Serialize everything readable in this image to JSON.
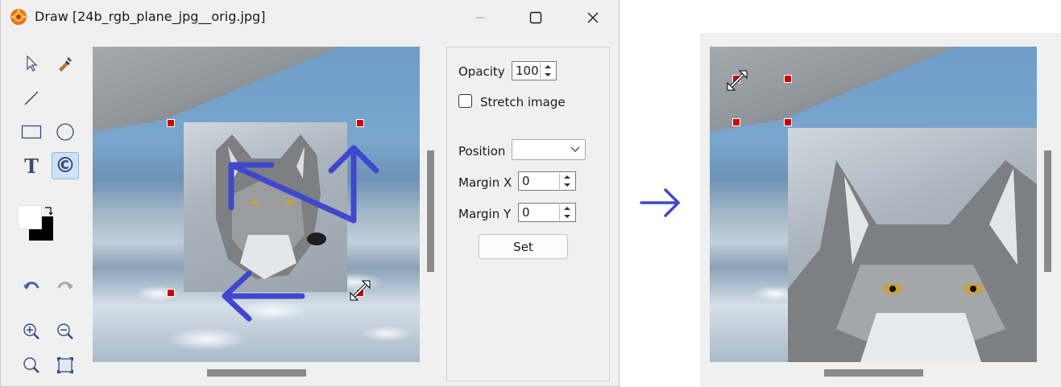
{
  "window": {
    "title": "Draw [24b_rgb_plane_jpg__orig.jpg]"
  },
  "toolbox": {
    "tools": [
      {
        "name": "select-tool",
        "icon": "cursor-icon"
      },
      {
        "name": "eyedropper-tool",
        "icon": "eyedropper-icon"
      },
      {
        "name": "line-tool",
        "icon": "line-icon"
      },
      {
        "name": "rectangle-tool",
        "icon": "rectangle-icon"
      },
      {
        "name": "ellipse-tool",
        "icon": "ellipse-icon"
      },
      {
        "name": "text-tool",
        "icon": "text-icon",
        "glyph": "T"
      },
      {
        "name": "image-stamp-tool",
        "icon": "copyright-icon",
        "glyph": "©",
        "active": true
      },
      {
        "name": "undo-tool",
        "icon": "undo-icon"
      },
      {
        "name": "redo-tool",
        "icon": "redo-icon"
      },
      {
        "name": "zoom-in-tool",
        "icon": "zoom-in-icon"
      },
      {
        "name": "zoom-out-tool",
        "icon": "zoom-out-icon"
      },
      {
        "name": "zoom-tool",
        "icon": "zoom-icon"
      },
      {
        "name": "fit-tool",
        "icon": "fit-to-window-icon"
      }
    ],
    "colors": {
      "foreground": "#ffffff",
      "background": "#000000"
    }
  },
  "panel": {
    "opacity_label": "Opacity",
    "opacity_value": "100",
    "stretch_label": "Stretch image",
    "stretch_checked": false,
    "position_label": "Position",
    "position_value": "",
    "margin_x_label": "Margin X",
    "margin_x_value": "0",
    "margin_y_label": "Margin Y",
    "margin_y_value": "0",
    "set_label": "Set"
  },
  "colors": {
    "accent_arrow": "#3f48cc",
    "handle": "#d00000",
    "scrollbar": "#8a8a8a"
  }
}
